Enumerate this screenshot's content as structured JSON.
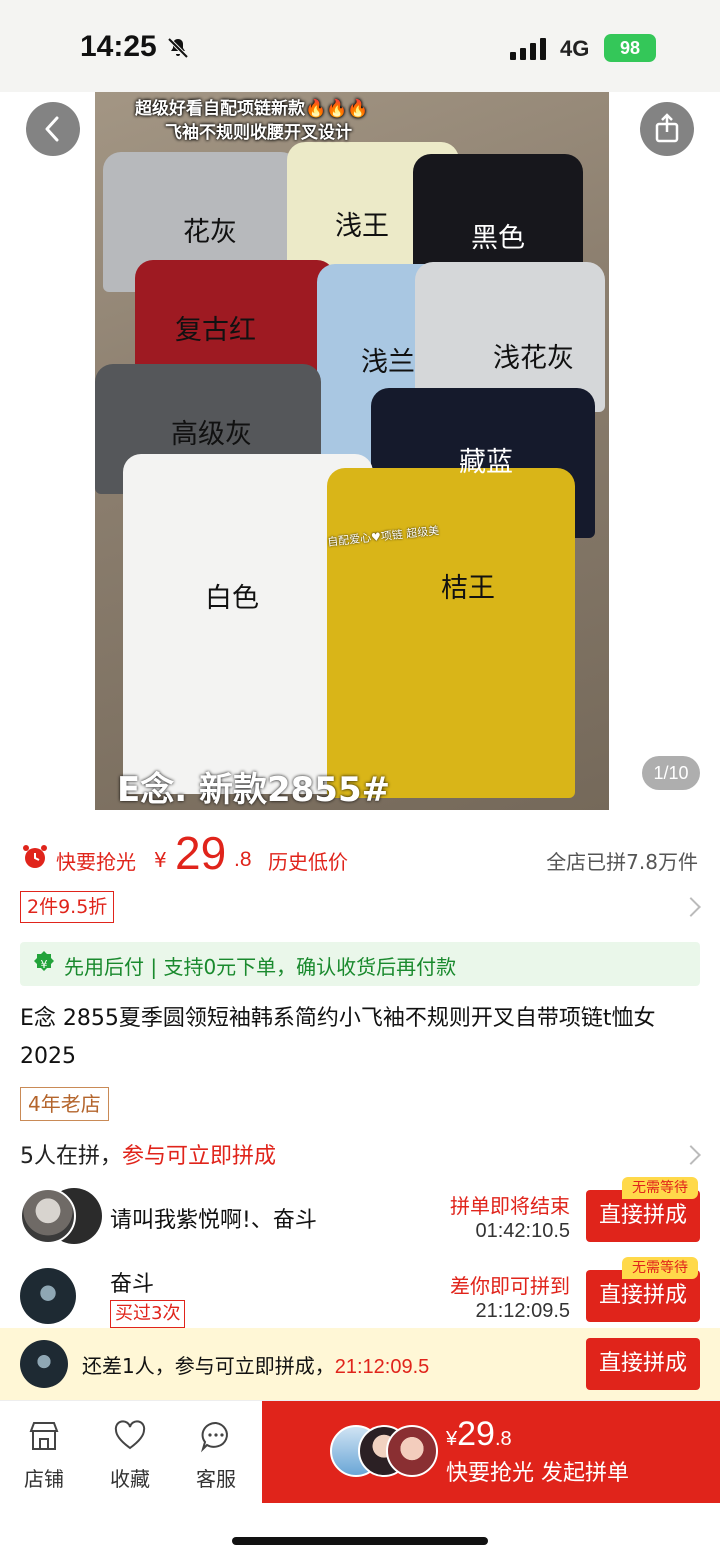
{
  "status_bar": {
    "time": "14:25",
    "network": "4G",
    "battery": "98"
  },
  "gallery": {
    "counter": "1/10",
    "photo_title_line1": "超级好看自配项链新款🔥🔥🔥",
    "photo_title_line2": "飞袖不规则收腰开叉设计",
    "photo_brand": "E念.  新款2855#",
    "photo_note": "自配爱心♥项链 超级美",
    "colors": [
      "花灰",
      "浅王",
      "黑色",
      "复古红",
      "浅兰",
      "浅花灰",
      "高级灰",
      "藏蓝",
      "白色",
      "桔王"
    ]
  },
  "price": {
    "flash_label": "快要抢光",
    "currency": "¥",
    "integer": "29",
    "decimal": ".8",
    "history_label": "历史低价",
    "sold_text": "全店已拼7.8万件"
  },
  "discount_tag": "2件9.5折",
  "pay_later": "先用后付 | 支持0元下单，确认收货后再付款",
  "product_title": "E念 2855夏季圆领短袖韩系简约小飞袖不规则开叉自带项链t恤女 2025",
  "shop_badge": "4年老店",
  "group": {
    "count_text": "5人在拼，",
    "join_text": "参与可立即拼成",
    "rows": [
      {
        "name": "请叫我紫悦啊!、奋斗",
        "status": "拼单即将结束",
        "timer": "01:42:10.5",
        "button": "直接拼成",
        "badge": "无需等待"
      },
      {
        "name": "奋斗",
        "bought": "买过3次",
        "status": "差你即可拼到",
        "timer": "21:12:09.5",
        "button": "直接拼成",
        "badge": "无需等待"
      }
    ]
  },
  "sticky": {
    "text": "还差1人，参与可立即拼成，",
    "timer": "21:12:09.5",
    "button": "直接拼成"
  },
  "bottom_bar": {
    "shop": "店铺",
    "favorite": "收藏",
    "service": "客服",
    "buy_price_currency": "¥",
    "buy_price_int": "29",
    "buy_price_dec": ".8",
    "buy_label": "快要抢光 发起拼单"
  },
  "colors_theme": {
    "accent": "#e0241b",
    "green": "#1a8a2e",
    "badge_yellow": "#ffd94a"
  }
}
